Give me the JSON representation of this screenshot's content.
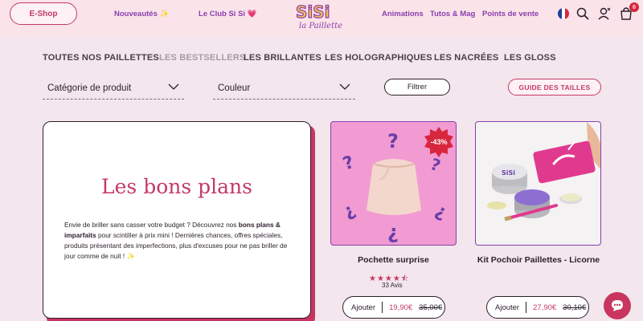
{
  "header": {
    "eshop_label": "E-Shop",
    "nav_left": [
      {
        "label": "Nouveautés ✨"
      },
      {
        "label": "Le Club Si Si 💗"
      }
    ],
    "nav_right": [
      {
        "label": "Animations"
      },
      {
        "label": "Tutos & Mag"
      },
      {
        "label": "Points de vente"
      }
    ],
    "logo_text": "Si Si la Paillette",
    "cart_count": "0",
    "icons": [
      "flag-fr-icon",
      "search-icon",
      "account-icon",
      "cart-icon"
    ]
  },
  "categories": [
    {
      "label": "TOUTES NOS PAILLETTES",
      "active": false
    },
    {
      "label": "LES BESTSELLERS",
      "active": true
    },
    {
      "label": "LES BRILLANTES",
      "active": false
    },
    {
      "label": "LES HOLOGRAPHIQUES",
      "active": false
    },
    {
      "label": "LES NACRÉES",
      "active": false
    },
    {
      "label": "LES GLOSS",
      "active": false
    }
  ],
  "filters": {
    "category_label": "Catégorie de produit",
    "color_label": "Couleur",
    "filter_button": "Filtrer",
    "size_guide_button": "GUIDE DES TAILLES"
  },
  "promo": {
    "title": "Les bons plans",
    "text_1": "Envie de briller sans casser votre budget ? Découvrez nos ",
    "bold_1": "bons plans & imparfaits",
    "text_2": " pour scintiller à prix mini ! Dernières chances, offres spéciales, produits présentant des imperfections, plus d'excuses pour ne pas briller de jour comme de nuit ! ✨"
  },
  "products": [
    {
      "name": "Pochette surprise",
      "discount": "-43%",
      "rating": 4.5,
      "stars": "★★★★⯪",
      "reviews": "33 Avis",
      "add_label": "Ajouter",
      "price": "19,90€",
      "old_price": "35,00€"
    },
    {
      "name": "Kit Pochoir Paillettes - Licorne",
      "add_label": "Ajouter",
      "price": "27,90€",
      "old_price": "30,10€"
    }
  ],
  "colors": {
    "accent": "#c43a66",
    "nav_purple": "#8a3fae",
    "header_bg": "#fbe3ea",
    "page_bg": "#f3e6ec",
    "badge_red": "#d7263d"
  }
}
